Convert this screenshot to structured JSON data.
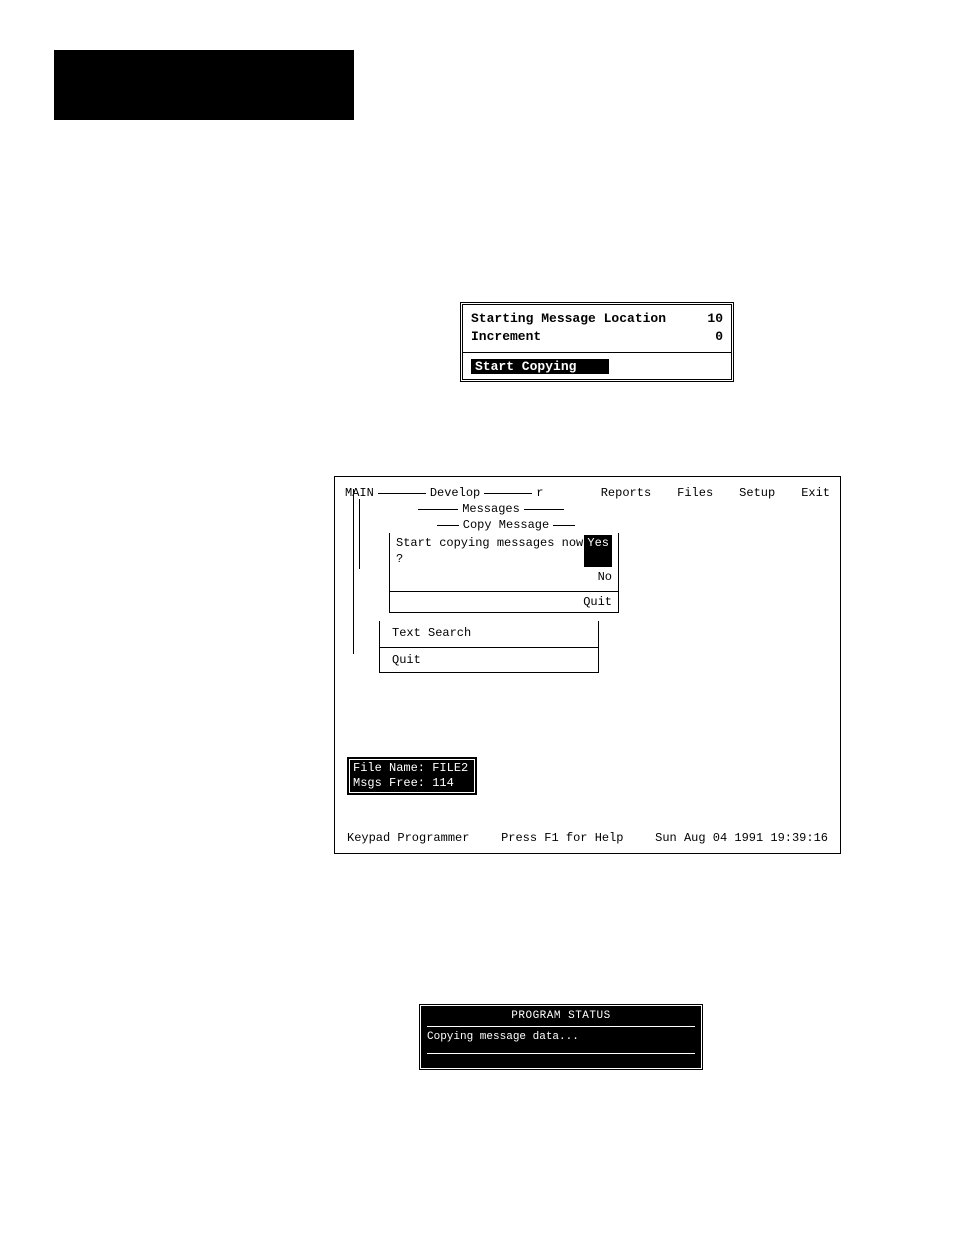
{
  "panel1": {
    "row1_label": "Starting Message Location",
    "row1_value": "10",
    "row2_label": "Increment",
    "row2_value": "0",
    "action": "Start Copying"
  },
  "app": {
    "main_label": "MAIN",
    "develop_label": "Develop",
    "develop_r": "r",
    "menu": {
      "reports": "Reports",
      "files": "Files",
      "setup": "Setup",
      "exit": "Exit"
    },
    "messages_label": "Messages",
    "copy_message_label": "Copy Message",
    "question": "Start copying messages now ?",
    "yes": "Yes",
    "no": "No",
    "quit": "Quit",
    "text_search": "Text Search",
    "quit2": "Quit",
    "fileinfo": {
      "name_label": "File Name:",
      "name_value": "FILE2",
      "free_label": "Msgs Free:",
      "free_value": "114"
    },
    "status": {
      "left": "Keypad Programmer",
      "center": "Press F1 for Help",
      "right": "Sun Aug 04 1991 19:39:16"
    }
  },
  "panel3": {
    "title": "PROGRAM STATUS",
    "body": "Copying message data..."
  }
}
